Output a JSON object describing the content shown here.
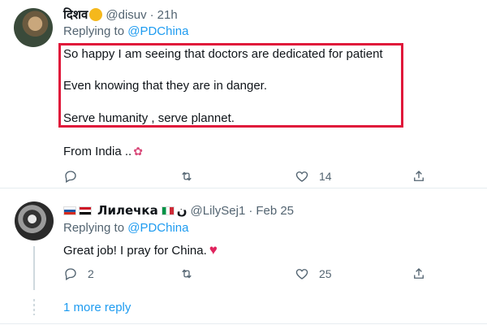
{
  "tweets": [
    {
      "name": "दिशव",
      "handle": "@disuv",
      "time": "21h",
      "replying_prefix": "Replying to ",
      "replying_to": "@PDChina",
      "lines": [
        "So happy I am seeing that doctors are dedicated for patient",
        "Even knowing that they are in danger.",
        "Serve humanity , serve plannet.",
        "From India .."
      ],
      "highlight_color": "#e0173a",
      "stats": {
        "replies": "",
        "retweets": "",
        "likes": "14"
      }
    },
    {
      "name": "Лилечка",
      "name_suffix": "ن",
      "handle": "@LilySej1",
      "time": "Feb 25",
      "replying_prefix": "Replying to ",
      "replying_to": "@PDChina",
      "text": "Great job! I pray for China.",
      "stats": {
        "replies": "2",
        "retweets": "",
        "likes": "25"
      }
    }
  ],
  "more_replies": "1 more reply",
  "colors": {
    "link": "#1d9bf0",
    "muted": "#536471",
    "heart": "#e0245e"
  }
}
